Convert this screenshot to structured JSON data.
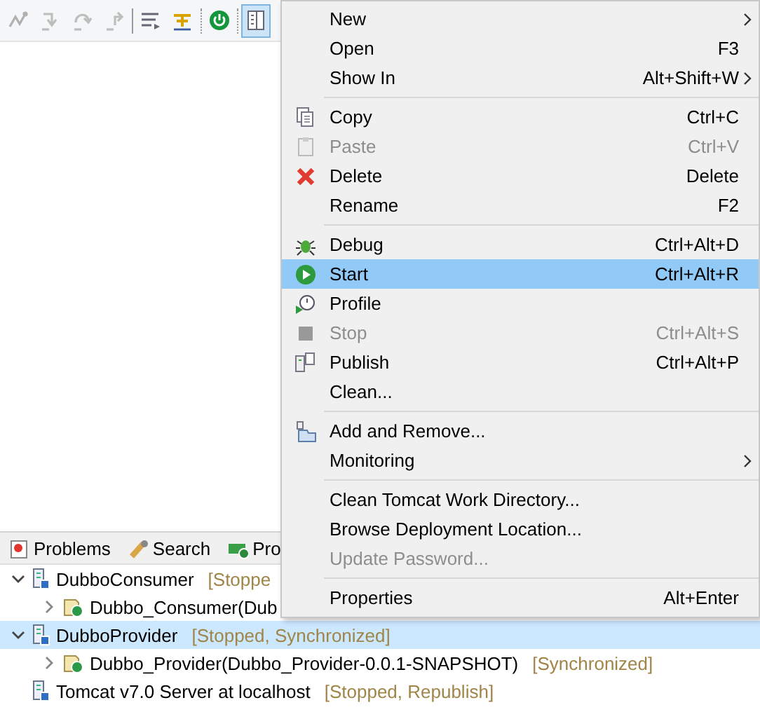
{
  "toolbar": [
    {
      "disabled": true,
      "pressed": false
    },
    {
      "disabled": true,
      "pressed": false
    },
    {
      "disabled": true,
      "pressed": false
    },
    {
      "disabled": true,
      "pressed": false
    },
    {
      "disabled": false,
      "pressed": false
    },
    {
      "disabled": false,
      "pressed": false
    },
    {
      "disabled": false,
      "pressed": false
    },
    {
      "disabled": false,
      "pressed": true
    }
  ],
  "panel": {
    "tabs": [
      {
        "label": "Problems",
        "selected": false
      },
      {
        "label": "Search",
        "selected": false
      },
      {
        "label": "Pro",
        "selected": false
      }
    ],
    "tree": [
      {
        "name": "DubboConsumer",
        "status": "[Stoppe",
        "expanded": true,
        "selected": false,
        "children": [
          {
            "name": "Dubbo_Consumer(Dub",
            "expanded": false,
            "selected": false
          }
        ]
      },
      {
        "name": "DubboProvider",
        "status": "[Stopped, Synchronized]",
        "expanded": true,
        "selected": true,
        "children": [
          {
            "name": "Dubbo_Provider(Dubbo_Provider-0.0.1-SNAPSHOT)",
            "status": "[Synchronized]",
            "expanded": false,
            "selected": false
          }
        ]
      },
      {
        "name": "Tomcat v7.0 Server at localhost",
        "status": "[Stopped, Republish]",
        "selected": false
      }
    ]
  },
  "menu": {
    "items": [
      {
        "kind": "item",
        "label": "New",
        "submenu": true,
        "disabled": false,
        "selected": false
      },
      {
        "kind": "item",
        "label": "Open",
        "shortcut": "F3",
        "disabled": false,
        "selected": false
      },
      {
        "kind": "item",
        "label": "Show In",
        "shortcut": "Alt+Shift+W",
        "submenu": true,
        "disabled": false,
        "selected": false
      },
      {
        "kind": "separator"
      },
      {
        "kind": "item",
        "label": "Copy",
        "shortcut": "Ctrl+C",
        "disabled": false,
        "selected": false
      },
      {
        "kind": "item",
        "label": "Paste",
        "shortcut": "Ctrl+V",
        "disabled": true,
        "selected": false
      },
      {
        "kind": "item",
        "label": "Delete",
        "shortcut": "Delete",
        "disabled": false,
        "selected": false
      },
      {
        "kind": "item",
        "label": "Rename",
        "shortcut": "F2",
        "disabled": false,
        "selected": false
      },
      {
        "kind": "separator"
      },
      {
        "kind": "item",
        "label": "Debug",
        "shortcut": "Ctrl+Alt+D",
        "disabled": false,
        "selected": false
      },
      {
        "kind": "item",
        "label": "Start",
        "shortcut": "Ctrl+Alt+R",
        "disabled": false,
        "selected": true
      },
      {
        "kind": "item",
        "label": "Profile",
        "disabled": false,
        "selected": false
      },
      {
        "kind": "item",
        "label": "Stop",
        "shortcut": "Ctrl+Alt+S",
        "disabled": true,
        "selected": false
      },
      {
        "kind": "item",
        "label": "Publish",
        "shortcut": "Ctrl+Alt+P",
        "disabled": false,
        "selected": false
      },
      {
        "kind": "item",
        "label": "Clean...",
        "disabled": false,
        "selected": false
      },
      {
        "kind": "separator"
      },
      {
        "kind": "item",
        "label": "Add and Remove...",
        "disabled": false,
        "selected": false
      },
      {
        "kind": "item",
        "label": "Monitoring",
        "submenu": true,
        "disabled": false,
        "selected": false
      },
      {
        "kind": "separator"
      },
      {
        "kind": "item",
        "label": "Clean Tomcat Work Directory...",
        "disabled": false,
        "selected": false
      },
      {
        "kind": "item",
        "label": "Browse Deployment Location...",
        "disabled": false,
        "selected": false
      },
      {
        "kind": "item",
        "label": "Update Password...",
        "disabled": true,
        "selected": false
      },
      {
        "kind": "separator"
      },
      {
        "kind": "item",
        "label": "Properties",
        "shortcut": "Alt+Enter",
        "disabled": false,
        "selected": false
      }
    ]
  }
}
